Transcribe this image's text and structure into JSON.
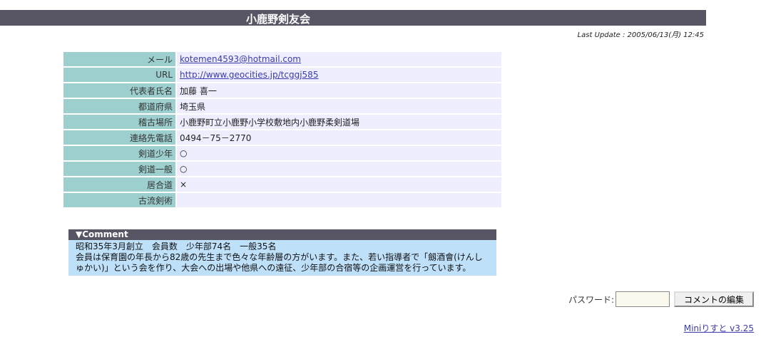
{
  "page": {
    "title": "小鹿野剣友会",
    "last_update": "Last Update : 2005/06/13(月) 12:45"
  },
  "info": [
    {
      "label": "メール",
      "value": "kotemen4593@hotmail.com",
      "link": true
    },
    {
      "label": "URL",
      "value": "http://www.geocities.jp/tcggj585",
      "link": true
    },
    {
      "label": "代表者氏名",
      "value": "加藤 喜一"
    },
    {
      "label": "都道府県",
      "value": "埼玉県"
    },
    {
      "label": "稽古場所",
      "value": "小鹿野町立小鹿野小学校敷地内小鹿野柔剣道場"
    },
    {
      "label": "連絡先電話",
      "value": "0494－75－2770"
    },
    {
      "label": "剣道少年",
      "value": "○"
    },
    {
      "label": "剣道一般",
      "value": "○"
    },
    {
      "label": "居合道",
      "value": "×"
    },
    {
      "label": "古流剣術",
      "value": ""
    }
  ],
  "comment": {
    "header": "▼Comment",
    "line1": "昭和35年3月創立　会員数　少年部74名　一般35名",
    "line2": "会員は保育園の年長から82歳の先生まで色々な年齢層の方がいます。また、若い指導者で「劔酒會(けんしゅかい)」という会を作り、大会への出場や他県への遠征、少年部の合宿等の企画運営を行っています。"
  },
  "password": {
    "label": "パスワード:",
    "value": "",
    "button": "コメントの編集"
  },
  "footer": {
    "version": "Miniりすと v3.25"
  }
}
